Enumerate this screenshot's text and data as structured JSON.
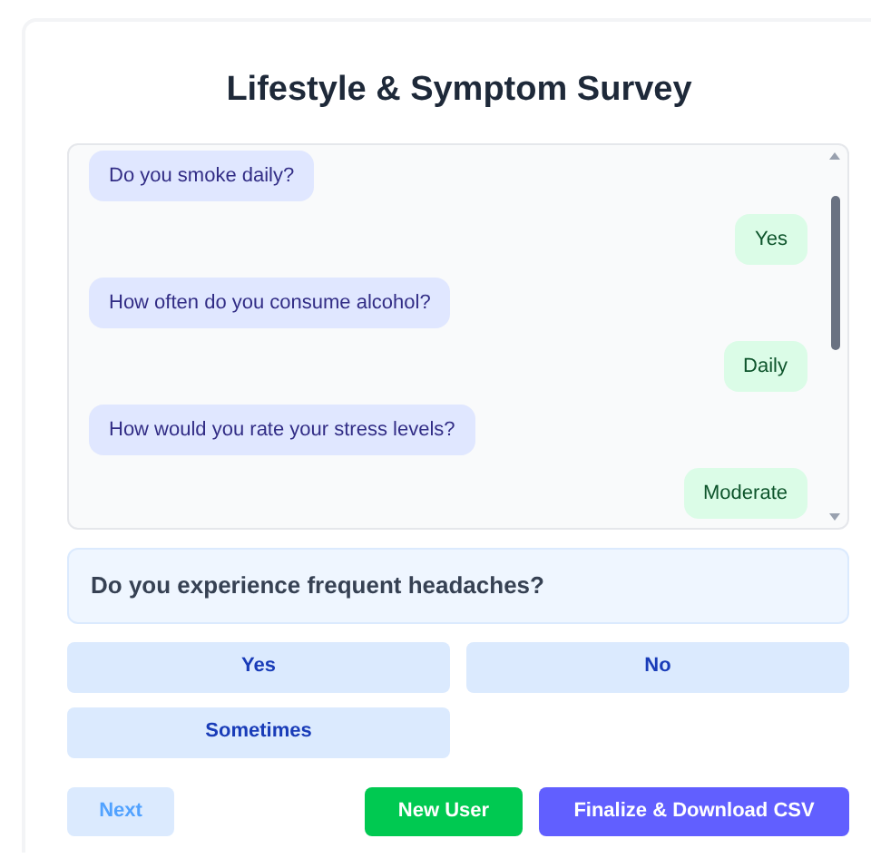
{
  "title": "Lifestyle & Symptom Survey",
  "messages": [
    {
      "kind": "question",
      "text": "Do you smoke daily?"
    },
    {
      "kind": "answer",
      "text": "Yes"
    },
    {
      "kind": "question",
      "text": "How often do you consume alcohol?"
    },
    {
      "kind": "answer",
      "text": "Daily"
    },
    {
      "kind": "question",
      "text": "How would you rate your stress levels?"
    },
    {
      "kind": "answer",
      "text": "Moderate"
    }
  ],
  "current_question": "Do you experience frequent headaches?",
  "options": [
    "Yes",
    "No",
    "Sometimes"
  ],
  "next_button": {
    "label": "Next",
    "disabled": true
  },
  "new_user_button": "New User",
  "finalize_button": "Finalize & Download CSV"
}
